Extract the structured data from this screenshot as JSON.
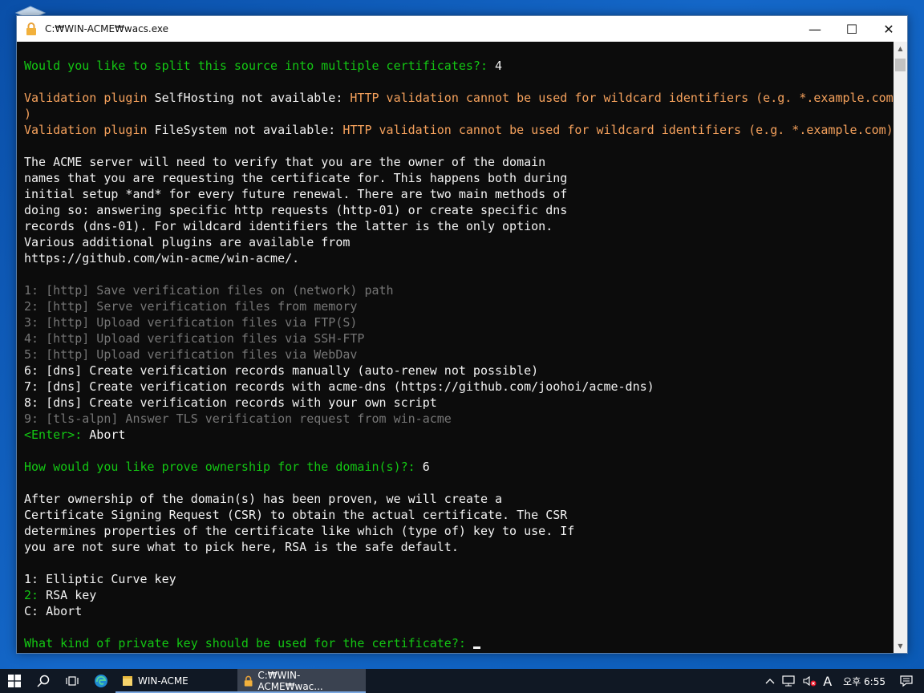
{
  "window": {
    "title": "C:₩WIN-ACME₩wacs.exe",
    "minimize_glyph": "—",
    "maximize_glyph": "☐",
    "close_glyph": "✕"
  },
  "console": {
    "lines": [
      {
        "segments": [
          {
            "text": "Would you like to split this source into multiple certificates?: ",
            "color": "g"
          },
          {
            "text": "4",
            "color": "w"
          }
        ]
      },
      {
        "segments": []
      },
      {
        "segments": [
          {
            "text": "Validation plugin ",
            "color": "o"
          },
          {
            "text": "SelfHosting",
            "color": "w"
          },
          {
            "text": " not available: ",
            "color": "w"
          },
          {
            "text": "HTTP validation cannot be used for wildcard identifiers (e.g. *.example.com",
            "color": "o"
          }
        ]
      },
      {
        "segments": [
          {
            "text": ")",
            "color": "o"
          }
        ]
      },
      {
        "segments": [
          {
            "text": "Validation plugin ",
            "color": "o"
          },
          {
            "text": "FileSystem",
            "color": "w"
          },
          {
            "text": " not available: ",
            "color": "w"
          },
          {
            "text": "HTTP validation cannot be used for wildcard identifiers (e.g. *.example.com)",
            "color": "o"
          }
        ]
      },
      {
        "segments": []
      },
      {
        "segments": [
          {
            "text": "The ACME server will need to verify that you are the owner of the domain",
            "color": "w"
          }
        ]
      },
      {
        "segments": [
          {
            "text": "names that you are requesting the certificate for. This happens both during",
            "color": "w"
          }
        ]
      },
      {
        "segments": [
          {
            "text": "initial setup *and* for every future renewal. There are two main methods of",
            "color": "w"
          }
        ]
      },
      {
        "segments": [
          {
            "text": "doing so: answering specific http requests (http-01) or create specific dns",
            "color": "w"
          }
        ]
      },
      {
        "segments": [
          {
            "text": "records (dns-01). For wildcard identifiers the latter is the only option.",
            "color": "w"
          }
        ]
      },
      {
        "segments": [
          {
            "text": "Various additional plugins are available from",
            "color": "w"
          }
        ]
      },
      {
        "segments": [
          {
            "text": "https://github.com/win-acme/win-acme/.",
            "color": "w"
          }
        ]
      },
      {
        "segments": []
      },
      {
        "segments": [
          {
            "text": "1: [http] Save verification files on (network) path",
            "color": "d"
          }
        ]
      },
      {
        "segments": [
          {
            "text": "2: [http] Serve verification files from memory",
            "color": "d"
          }
        ]
      },
      {
        "segments": [
          {
            "text": "3: [http] Upload verification files via FTP(S)",
            "color": "d"
          }
        ]
      },
      {
        "segments": [
          {
            "text": "4: [http] Upload verification files via SSH-FTP",
            "color": "d"
          }
        ]
      },
      {
        "segments": [
          {
            "text": "5: [http] Upload verification files via WebDav",
            "color": "d"
          }
        ]
      },
      {
        "segments": [
          {
            "text": "6: [dns] Create verification records manually (auto-renew not possible)",
            "color": "w"
          }
        ]
      },
      {
        "segments": [
          {
            "text": "7: [dns] Create verification records with acme-dns (https://github.com/joohoi/acme-dns)",
            "color": "w"
          }
        ]
      },
      {
        "segments": [
          {
            "text": "8: [dns] Create verification records with your own script",
            "color": "w"
          }
        ]
      },
      {
        "segments": [
          {
            "text": "9: [tls-alpn] Answer TLS verification request from win-acme",
            "color": "d"
          }
        ]
      },
      {
        "segments": [
          {
            "text": "<Enter>: ",
            "color": "g"
          },
          {
            "text": "Abort",
            "color": "w"
          }
        ]
      },
      {
        "segments": []
      },
      {
        "segments": [
          {
            "text": "How would you like prove ownership for the domain(s)?: ",
            "color": "g"
          },
          {
            "text": "6",
            "color": "w"
          }
        ]
      },
      {
        "segments": []
      },
      {
        "segments": [
          {
            "text": "After ownership of the domain(s) has been proven, we will create a",
            "color": "w"
          }
        ]
      },
      {
        "segments": [
          {
            "text": "Certificate Signing Request (CSR) to obtain the actual certificate. The CSR",
            "color": "w"
          }
        ]
      },
      {
        "segments": [
          {
            "text": "determines properties of the certificate like which (type of) key to use. If",
            "color": "w"
          }
        ]
      },
      {
        "segments": [
          {
            "text": "you are not sure what to pick here, RSA is the safe default.",
            "color": "w"
          }
        ]
      },
      {
        "segments": []
      },
      {
        "segments": [
          {
            "text": "1: Elliptic Curve key",
            "color": "w"
          }
        ]
      },
      {
        "segments": [
          {
            "text": "2: ",
            "color": "g"
          },
          {
            "text": "RSA key",
            "color": "w"
          }
        ]
      },
      {
        "segments": [
          {
            "text": "C: Abort",
            "color": "w"
          }
        ]
      },
      {
        "segments": []
      },
      {
        "segments": [
          {
            "text": "What kind of private key should be used for the certificate?: ",
            "color": "g"
          }
        ],
        "cursor": true
      }
    ]
  },
  "taskbar": {
    "tasks": [
      {
        "label": "WIN-ACME",
        "icon": "folder-icon"
      },
      {
        "label": "C:₩WIN-ACME₩wac...",
        "icon": "lock-icon"
      }
    ],
    "tray": {
      "input_indicator": "A",
      "clock": "오후 6:55"
    }
  },
  "colors": {
    "green": "#13c713",
    "orange": "#f5a15c",
    "white": "#f2f2f2",
    "dim": "#767676"
  }
}
